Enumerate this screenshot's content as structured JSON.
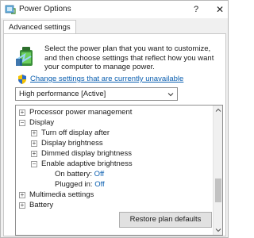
{
  "window": {
    "title": "Power Options",
    "help_label": "?",
    "close_label": "✕"
  },
  "tabs": [
    {
      "label": "Advanced settings",
      "active": true
    }
  ],
  "intro_text": "Select the power plan that you want to customize, and then choose settings that reflect how you want your computer to manage power.",
  "change_link": "Change settings that are currently unavailable",
  "plan_select": {
    "value": "High performance [Active]"
  },
  "tree": {
    "rows": [
      {
        "marker": "+",
        "label": "Processor power management"
      },
      {
        "marker": "−",
        "label": "Display"
      },
      {
        "marker": "+",
        "label": "Turn off display after"
      },
      {
        "marker": "+",
        "label": "Display brightness"
      },
      {
        "marker": "+",
        "label": "Dimmed display brightness"
      },
      {
        "marker": "−",
        "label": "Enable adaptive brightness"
      },
      {
        "label": "On battery:",
        "value": "Off"
      },
      {
        "label": "Plugged in:",
        "value": "Off"
      },
      {
        "marker": "+",
        "label": "Multimedia settings"
      },
      {
        "marker": "+",
        "label": "Battery"
      }
    ]
  },
  "buttons": {
    "restore_defaults": "Restore plan defaults"
  },
  "colors": {
    "link": "#0b5fb0",
    "value": "#0b5fb0",
    "panel_bg": "#ffffff",
    "window_bg": "#f0f0f0"
  }
}
